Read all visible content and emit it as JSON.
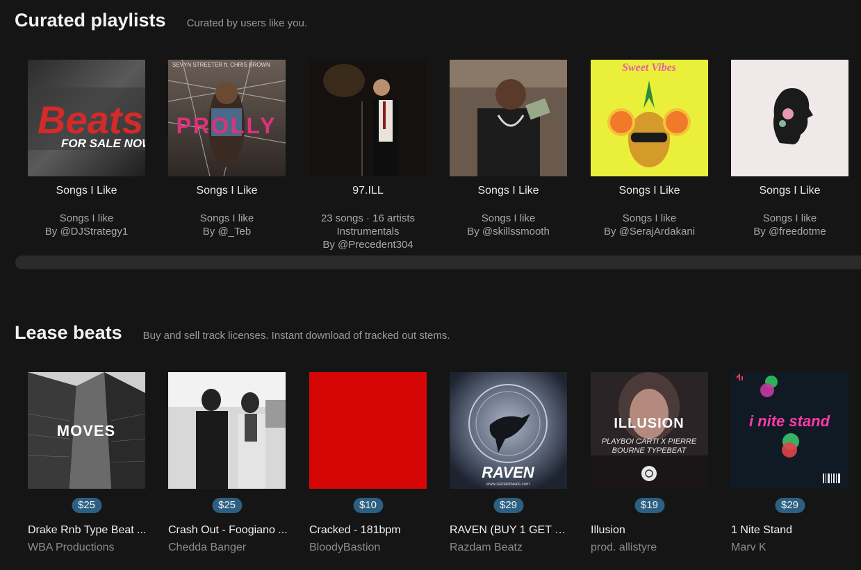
{
  "curated": {
    "title": "Curated playlists",
    "subtitle": "Curated by users like you.",
    "items": [
      {
        "title": "Songs I Like",
        "lines": [
          "Songs I like",
          "By @DJStrategy1"
        ]
      },
      {
        "title": "Songs I Like",
        "lines": [
          "Songs I like",
          "By @_Teb"
        ]
      },
      {
        "title": "97.ILL",
        "lines": [
          "23 songs · 16 artists",
          "Instrumentals",
          "By @Precedent304"
        ]
      },
      {
        "title": "Songs I Like",
        "lines": [
          "Songs I like",
          "By @skillssmooth"
        ]
      },
      {
        "title": "Songs I Like",
        "lines": [
          "Songs I like",
          "By @SerajArdakani"
        ]
      },
      {
        "title": "Songs I Like",
        "lines": [
          "Songs I like",
          "By @freedotme"
        ]
      }
    ],
    "art_text": {
      "beats_big": "Beats",
      "beats_small": "FOR SALE NOW",
      "prolly": "PROLLY",
      "prolly_top": "SEVYN STREETER ft. CHRIS BROWN",
      "sweet": "Sweet Vibes"
    }
  },
  "lease": {
    "title": "Lease beats",
    "subtitle": "Buy and sell track licenses. Instant download of tracked out stems.",
    "items": [
      {
        "price": "$25",
        "title": "Drake Rnb Type Beat ...",
        "artist": "WBA Productions"
      },
      {
        "price": "$25",
        "title": "Crash Out - Foogiano ...",
        "artist": "Chedda Banger"
      },
      {
        "price": "$10",
        "title": "Cracked - 181bpm",
        "artist": "BloodyBastion"
      },
      {
        "price": "$29",
        "title": "RAVEN (BUY 1 GET 4 ...",
        "artist": "Razdam Beatz"
      },
      {
        "price": "$19",
        "title": "Illusion",
        "artist": "prod. allistyre"
      },
      {
        "price": "$29",
        "title": "1 Nite Stand",
        "artist": "Marv K"
      }
    ],
    "art_text": {
      "moves": "MOVES",
      "raven": "RAVEN",
      "raven_site": "www.razdambeats.com",
      "illusion": "ILLUSION",
      "illusion_sub1": "PLAYBOI CARTI X PIERRE",
      "illusion_sub2": "BOURNE TYPEBEAT",
      "nite": "i nite stand"
    }
  },
  "colors": {
    "background": "#151515",
    "price_badge": "#2c5f82",
    "muted_text": "#9a9a9a"
  }
}
